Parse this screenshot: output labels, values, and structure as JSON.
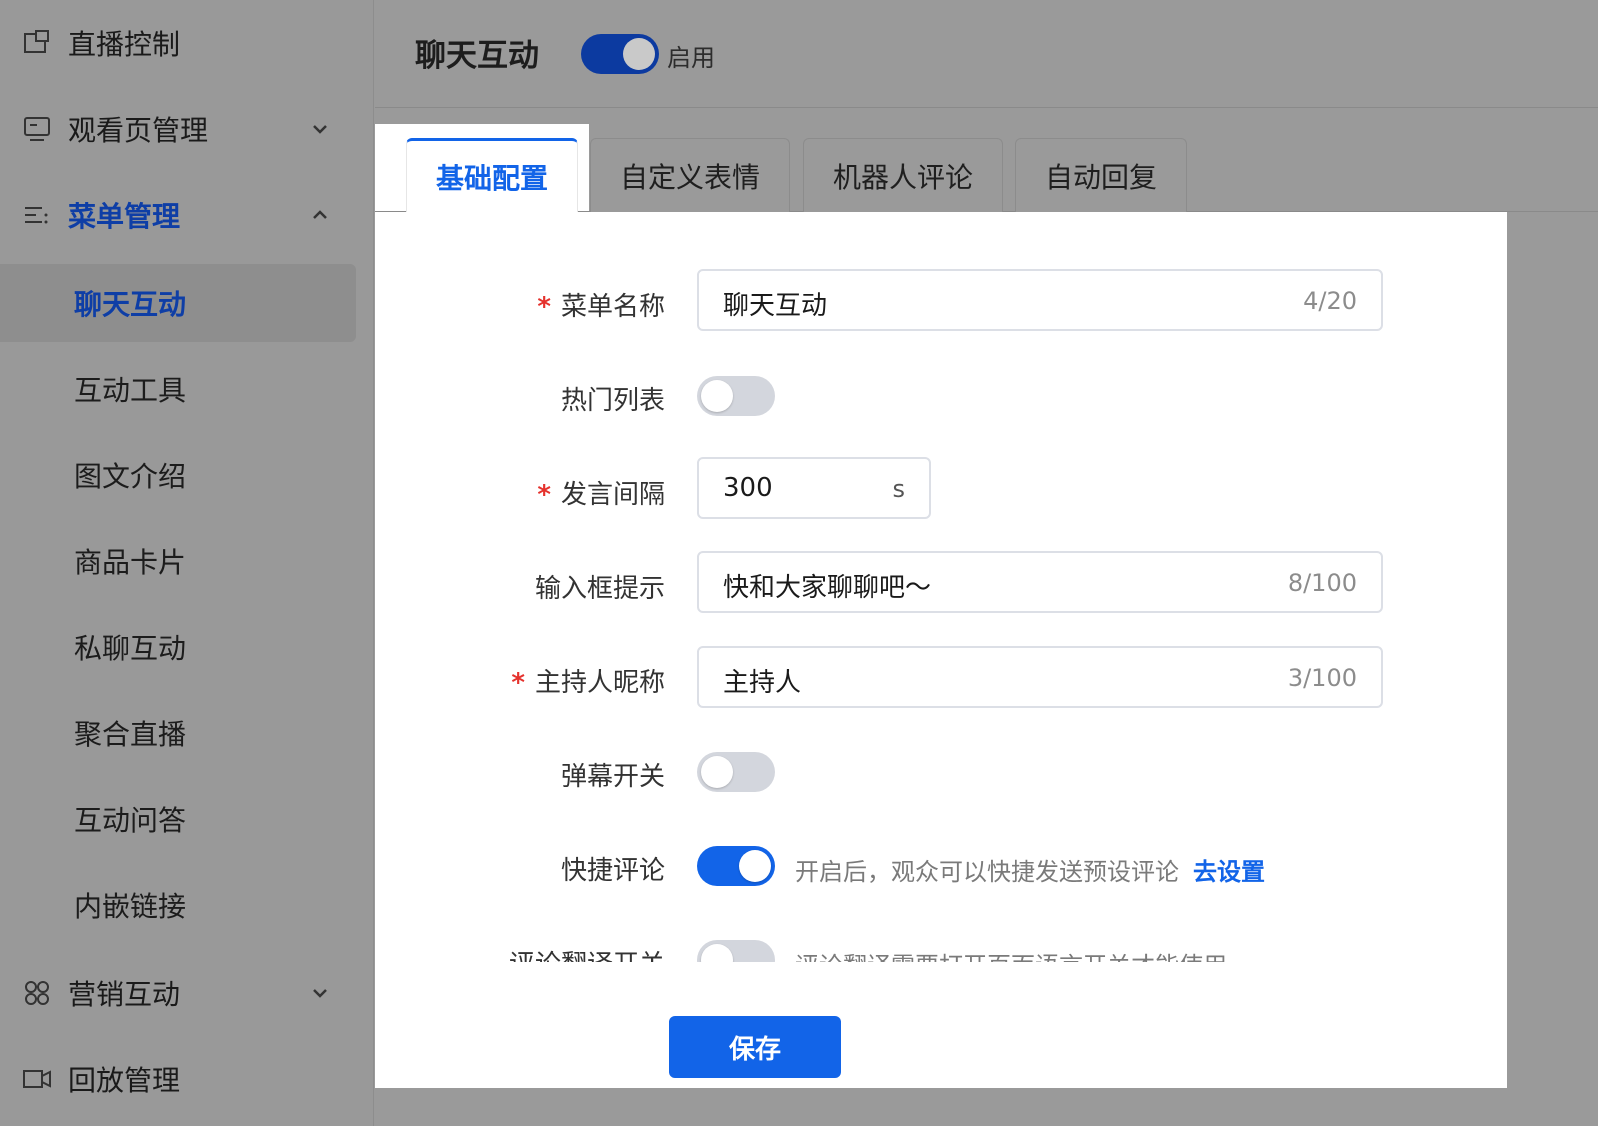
{
  "sidebar": {
    "live_control": "直播控制",
    "watch_page": "观看页管理",
    "menu_mgmt": "菜单管理",
    "sub_items": [
      "聊天互动",
      "互动工具",
      "图文介绍",
      "商品卡片",
      "私聊互动",
      "聚合直播",
      "互动问答",
      "内嵌链接"
    ],
    "marketing": "营销互动",
    "replay": "回放管理"
  },
  "header": {
    "title": "聊天互动",
    "enabled": true,
    "toggle_label": "启用"
  },
  "tabs": [
    "基础配置",
    "自定义表情",
    "机器人评论",
    "自动回复"
  ],
  "active_tab": 0,
  "form": {
    "menu_name": {
      "label": "菜单名称",
      "required": true,
      "value": "聊天互动",
      "count": "4/20"
    },
    "hot_list": {
      "label": "热门列表",
      "on": false
    },
    "interval": {
      "label": "发言间隔",
      "required": true,
      "value": "300",
      "unit": "s"
    },
    "placeholder": {
      "label": "输入框提示",
      "value": "快和大家聊聊吧～",
      "count": "8/100"
    },
    "host_nick": {
      "label": "主持人昵称",
      "required": true,
      "value": "主持人",
      "count": "3/100"
    },
    "danmaku": {
      "label": "弹幕开关",
      "on": false
    },
    "quick_comment": {
      "label": "快捷评论",
      "on": true,
      "hint": "开启后，观众可以快捷发送预设评论",
      "link": "去设置"
    },
    "translate": {
      "label": "评论翻译开关",
      "on": false,
      "hint": "评论翻译需要打开页面语言开关才能使用"
    }
  },
  "save_label": "保存",
  "colors": {
    "primary": "#1264e8",
    "header_toggle": "#0c3aa0",
    "required": "#e5322d"
  }
}
